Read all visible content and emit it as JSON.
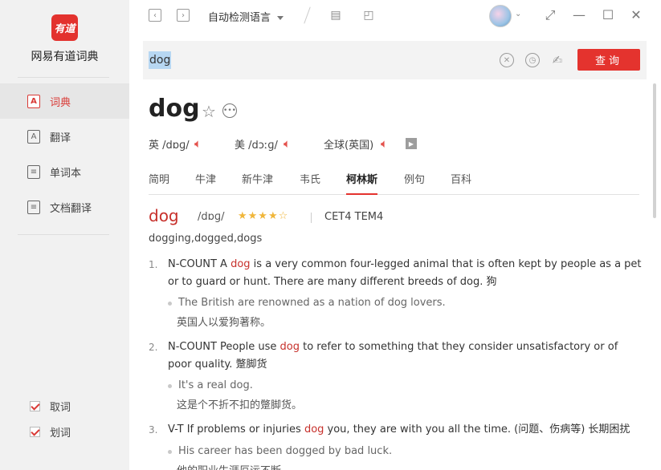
{
  "app": {
    "logo_text": "有道",
    "name": "网易有道词典"
  },
  "sidebar": {
    "items": [
      {
        "label": "词典",
        "icon": "A"
      },
      {
        "label": "翻译",
        "icon": "A"
      },
      {
        "label": "单词本",
        "icon": "≡"
      },
      {
        "label": "文档翻译",
        "icon": "≡"
      }
    ],
    "checks": [
      {
        "label": "取词",
        "checked": true
      },
      {
        "label": "划词",
        "checked": true
      }
    ]
  },
  "titlebar": {
    "back": "‹",
    "forward": "›",
    "language": "自动检测语言"
  },
  "search": {
    "value": "dog",
    "button": "查询"
  },
  "word": {
    "headword": "dog",
    "uk_label": "英",
    "uk_phonetic": "/dɒɡ/",
    "us_label": "美",
    "us_phonetic": "/dɔːɡ/",
    "global_label": "全球(英国)"
  },
  "tabs": [
    "简明",
    "牛津",
    "新牛津",
    "韦氏",
    "柯林斯",
    "例句",
    "百科"
  ],
  "active_tab": "柯林斯",
  "collins": {
    "word": "dog",
    "phonetic": "/dɒɡ/",
    "stars": "★★★★☆",
    "tags": "CET4 TEM4",
    "forms": "dogging,dogged,dogs",
    "senses": [
      {
        "num": "1.",
        "pre": "N-COUNT A ",
        "hl": "dog",
        "post": " is a very common four-legged animal that is often kept by people as a pet or to guard or hunt. There are many different breeds of dog. 狗",
        "ex_en": "The British are renowned as a nation of dog lovers.",
        "ex_zh": "英国人以爱狗著称。"
      },
      {
        "num": "2.",
        "pre": "N-COUNT People use ",
        "hl": "dog",
        "post": " to refer to something that they consider unsatisfactory or of poor quality. 蹩脚货",
        "ex_en": "It's a real dog.",
        "ex_zh": "这是个不折不扣的蹩脚货。"
      },
      {
        "num": "3.",
        "pre": "V-T If problems or injuries ",
        "hl": "dog",
        "post": " you, they are with you all the time. (问题、伤病等) 长期困扰",
        "ex_en": "His career has been dogged by bad luck.",
        "ex_zh": "他的职业生涯厄运不断。"
      }
    ]
  },
  "colors": {
    "accent": "#e4332e",
    "highlight": "#c7302b",
    "sidebar_bg": "#f1f1f1"
  }
}
